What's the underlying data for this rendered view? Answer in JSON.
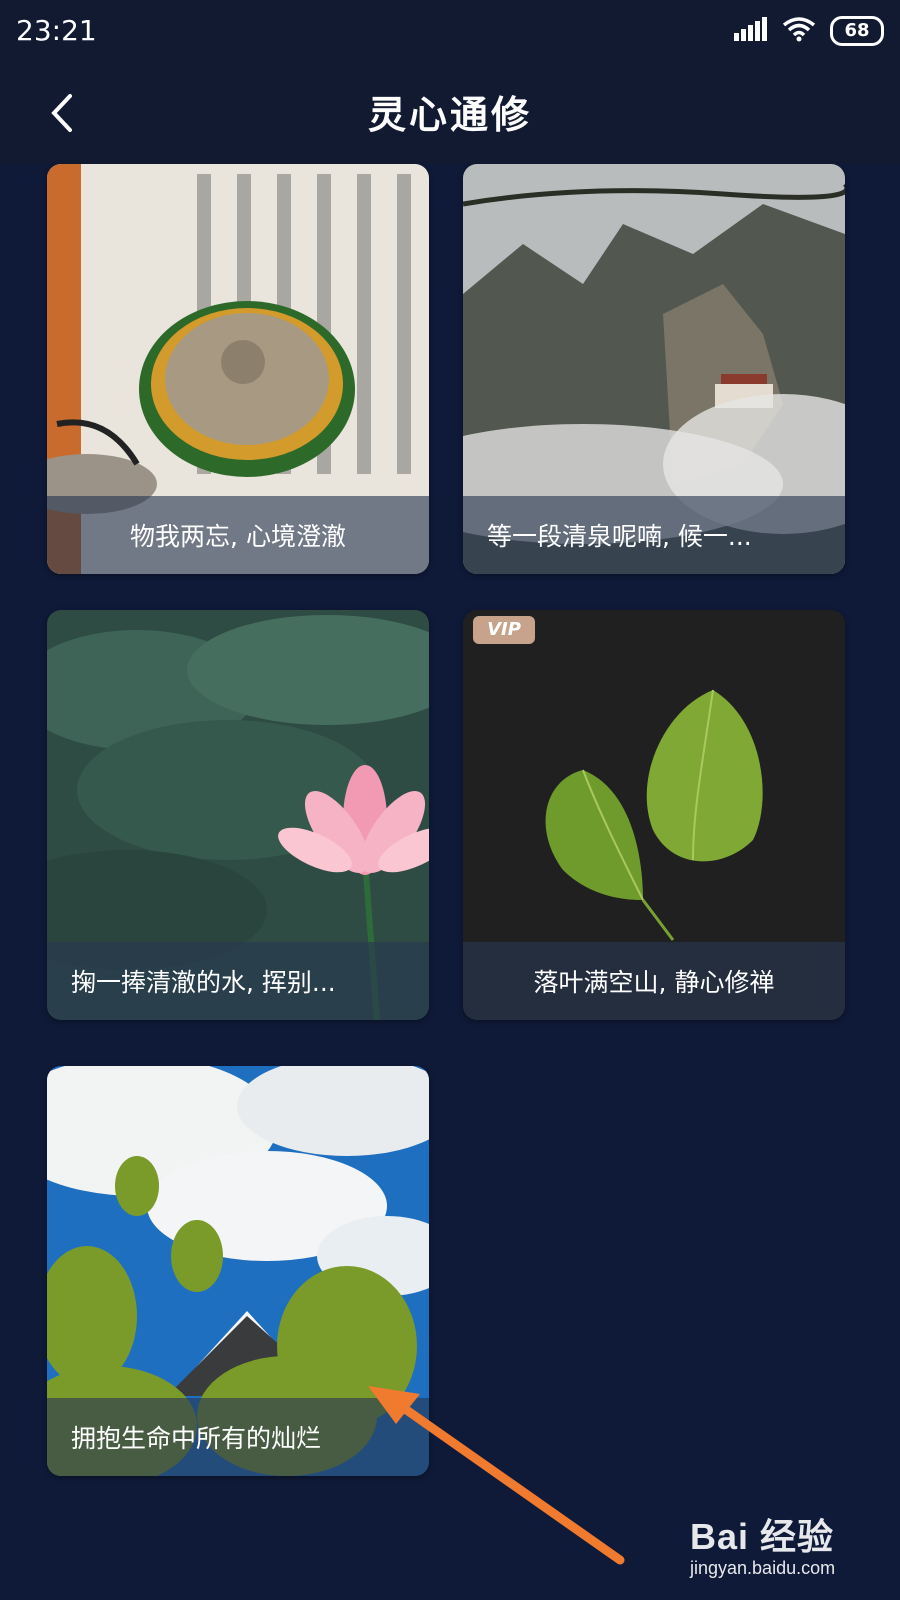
{
  "status_bar": {
    "time": "23:21",
    "battery": "68"
  },
  "header": {
    "title": "灵心通修"
  },
  "cards": [
    {
      "caption": "物我两忘, 心境澄澈"
    },
    {
      "caption": "等一段清泉呢喃, 候一..."
    },
    {
      "caption": "掬一捧清澈的水, 挥别..."
    },
    {
      "caption": "落叶满空山, 静心修禅",
      "badge": "VIP"
    },
    {
      "caption": "拥抱生命中所有的灿烂"
    }
  ],
  "watermark": {
    "logo": "Bai 经验",
    "url": "jingyan.baidu.com"
  }
}
